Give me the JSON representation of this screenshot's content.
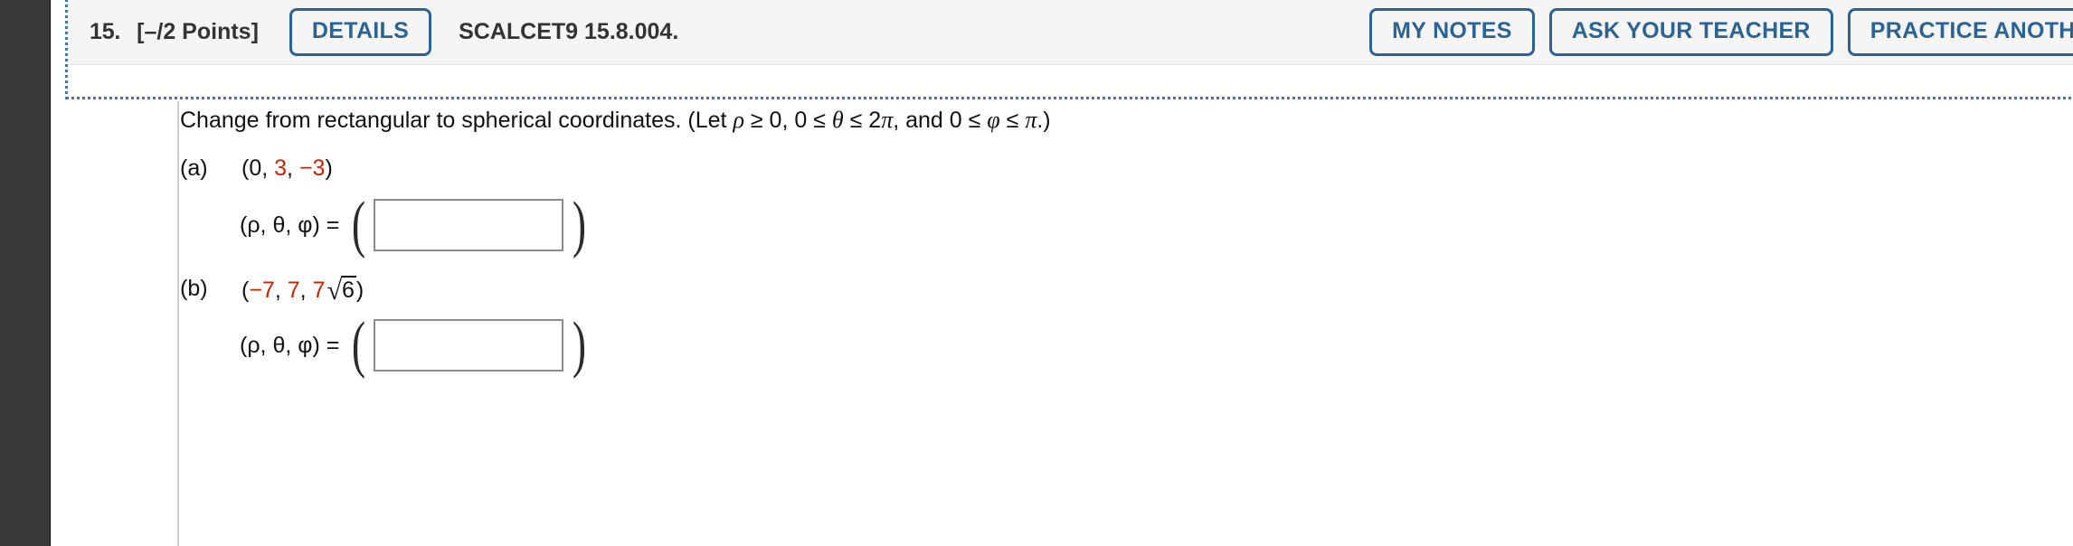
{
  "header": {
    "question_number": "15.",
    "points": "[–/2 Points]",
    "details_label": "DETAILS",
    "source": "SCALCET9 15.8.004.",
    "my_notes_label": "MY NOTES",
    "ask_teacher_label": "ASK YOUR TEACHER",
    "practice_label": "PRACTICE ANOTHER",
    "accent_color": "#2a6496",
    "focus_outline_color": "#2f7ac4"
  },
  "question": {
    "prompt_part1": "Change from rectangular to spherical coordinates. (Let ",
    "rho": "ρ",
    "prompt_part2": " ≥ 0, 0 ≤ ",
    "theta": "θ",
    "prompt_part3": " ≤ 2",
    "pi": "π",
    "prompt_part4": ", and 0 ≤ ",
    "phi": "φ",
    "prompt_part5": " ≤ ",
    "prompt_part6": ".)",
    "full_prompt": "Change from rectangular to spherical coordinates. (Let ρ ≥ 0, 0 ≤ θ ≤ 2π, and 0 ≤ φ ≤ π.)"
  },
  "parts": [
    {
      "label": "(a)",
      "point_open": "(0, ",
      "point_x": "0",
      "point_y": "3",
      "point_z": "−3",
      "point_text": "(0, 3, −3)",
      "tuple_label": "(ρ, θ, φ)  =",
      "left_paren": "(",
      "right_paren": ")",
      "answer_value": "",
      "answer_placeholder": ""
    },
    {
      "label": "(b)",
      "point_x": "−7",
      "point_y": "7",
      "point_z_coeff": "7",
      "point_z_radical_sign": "√",
      "point_z_radicand": "6",
      "point_text": "(−7, 7, 7√6)",
      "tuple_label": "(ρ, θ, φ)  =",
      "left_paren": "(",
      "right_paren": ")",
      "answer_value": "",
      "answer_placeholder": ""
    }
  ],
  "colors": {
    "value_red": "#cc2200",
    "text_black": "#111111",
    "header_bg": "#f5f5f5",
    "rail_dark": "#3a3a3a",
    "rule_gray": "#cdcdcd"
  }
}
